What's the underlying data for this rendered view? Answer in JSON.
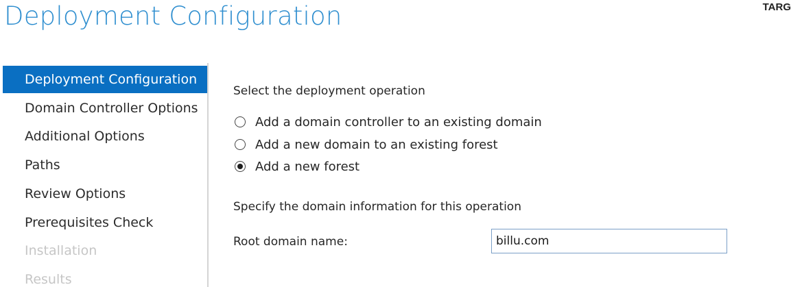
{
  "header": {
    "title": "Deployment Configuration",
    "target_label": "TARG"
  },
  "nav": {
    "items": [
      {
        "label": "Deployment Configuration",
        "state": "active"
      },
      {
        "label": "Domain Controller Options",
        "state": "enabled"
      },
      {
        "label": "Additional Options",
        "state": "enabled"
      },
      {
        "label": "Paths",
        "state": "enabled"
      },
      {
        "label": "Review Options",
        "state": "enabled"
      },
      {
        "label": "Prerequisites Check",
        "state": "enabled"
      },
      {
        "label": "Installation",
        "state": "disabled"
      },
      {
        "label": "Results",
        "state": "disabled"
      }
    ]
  },
  "main": {
    "operation_heading": "Select the deployment operation",
    "operations": [
      {
        "label": "Add a domain controller to an existing domain",
        "checked": false
      },
      {
        "label": "Add a new domain to an existing forest",
        "checked": false
      },
      {
        "label": "Add a new forest",
        "checked": true
      }
    ],
    "domain_heading": "Specify the domain information for this operation",
    "root_domain_label": "Root domain name:",
    "root_domain_value": "billu.com"
  },
  "colors": {
    "title": "#2e8ecf",
    "nav_active_bg": "#0a6fc2",
    "nav_disabled_text": "#c6c6c6"
  }
}
